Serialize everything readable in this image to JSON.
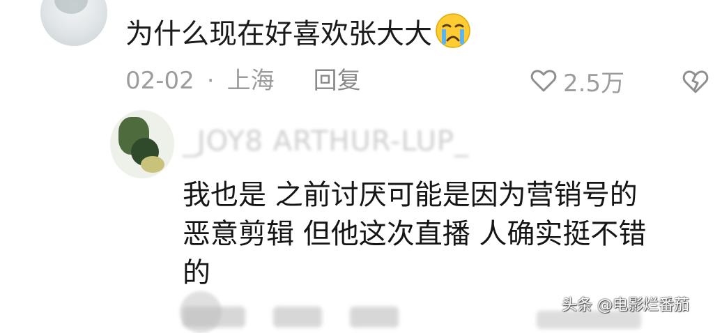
{
  "comment": {
    "text": "为什么现在好喜欢张大大",
    "emoji_icon": "crying-face-emoji",
    "date": "02-02",
    "separator": "·",
    "location": "上海",
    "reply_label": "回复",
    "like_count": "2.5万",
    "like_icon": "heart-outline-icon",
    "dislike_icon": "broken-heart-icon"
  },
  "reply": {
    "username": "_JOY8 ARTHUR-LUP_",
    "lines": [
      "我也是  之前讨厌可能是因为营销号的",
      "恶意剪辑  但他这次直播 人确实挺不错",
      "的"
    ]
  },
  "watermark": "头条 @电影烂番茄",
  "colors": {
    "text_primary": "#1a1a1a",
    "text_secondary": "#9c9c9c",
    "background": "#ffffff"
  }
}
